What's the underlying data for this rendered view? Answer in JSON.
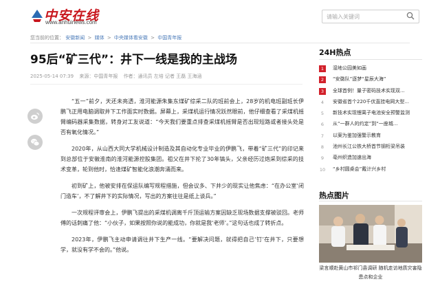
{
  "header": {
    "logo_text": "中安在线",
    "logo_domain": "www.anhuinews.com",
    "search_placeholder": "请输入关键词"
  },
  "breadcrumb": {
    "prefix": "您当前的位置：",
    "items": [
      "安徽新闻",
      "媒体",
      "中央媒体看安徽",
      "中国青年报"
    ]
  },
  "article": {
    "title": "95后“矿三代”：井下一线是我的主战场",
    "date": "2025-05-14 07:39",
    "source": "来源：中国青年报",
    "author": "作者：通讯员 左培 记者 王磊 王海涵",
    "paragraphs": [
      "“五一”前夕，天还未亮透，淮河能源朱集东煤矿综采二队的班前会上，28岁的机电班副班长伊鹏飞正用电脑调取井下工作面实时数据。屏幕上，采煤机运行情况跃然眼前，他仔细查看了采煤机摇臂编码器采集数据，转身对工友说道：“今天我们要重点排查采煤机摇臂是否出现短路或者接头处是否有氧化情况。”",
      "2020年，从山西大同大学机械设计制造及其自动化专业毕业的伊鹏飞，带着“矿三代”的印记来到总部位于安徽淮南的淮河能源控股集团。祖父在井下抡了30年镐头，父亲经历过炮采到综采的技术变革，轮到他时，恰逢煤矿智能化浪潮奔涌而来。",
      "初到矿上，他被安排在保运队编写规程措施，但会议多、下井少的现实让他焦虑：“在办公室‘闭门造车’，不了解井下的实际情况，写出的方案往往是纸上谈兵。”",
      "一次规程评审会上，伊鹏飞提出的采煤机调离千斤顶运输方案因缺乏现场数据支撑被驳回。老师傅的话刺痛了他：“小伙子，如果按照你说的能成功，你就是我‘老师’。”这句话也成了转折点。",
      "2023年，伊鹏飞主动申请调往井下生产一线。“要解决问题，就得把自己‘钉’在井下，只要想学，就没有学不会的。”他说。"
    ]
  },
  "share": {
    "weibo_icon": "weibo-icon",
    "wechat_icon": "wechat-icon"
  },
  "sidebar": {
    "hot_title": "24H热点",
    "hot_items": [
      {
        "num": "1",
        "text": "湿地公园美如画"
      },
      {
        "num": "2",
        "text": "“安徽队”逐梦“星辰大海”"
      },
      {
        "num": "3",
        "text": "全球首例！量子密码技术实现双..."
      },
      {
        "num": "4",
        "text": "安徽省首个220千伏直挂电网大型..."
      },
      {
        "num": "5",
        "text": "新技术实现锂离子电池安全预警监测"
      },
      {
        "num": "6",
        "text": "从“一群人的约定”到“一座城..."
      },
      {
        "num": "7",
        "text": "以案为鉴加强警示教育"
      },
      {
        "num": "8",
        "text": "池州长江公铁大桥首节钢桁梁吊装"
      },
      {
        "num": "9",
        "text": "亳州织造加速出海"
      },
      {
        "num": "10",
        "text": "“乡村圆桌会”戴计兴乡村"
      }
    ],
    "pic_title": "热点图片",
    "pic_caption": "梁言顺赴黄山市祁门县调研 随机走访地质灾害隐患点和企业"
  },
  "colors": {
    "brand_red": "#c8161d",
    "link_blue": "#4a7ab8",
    "rank_red": "#d2202a"
  }
}
